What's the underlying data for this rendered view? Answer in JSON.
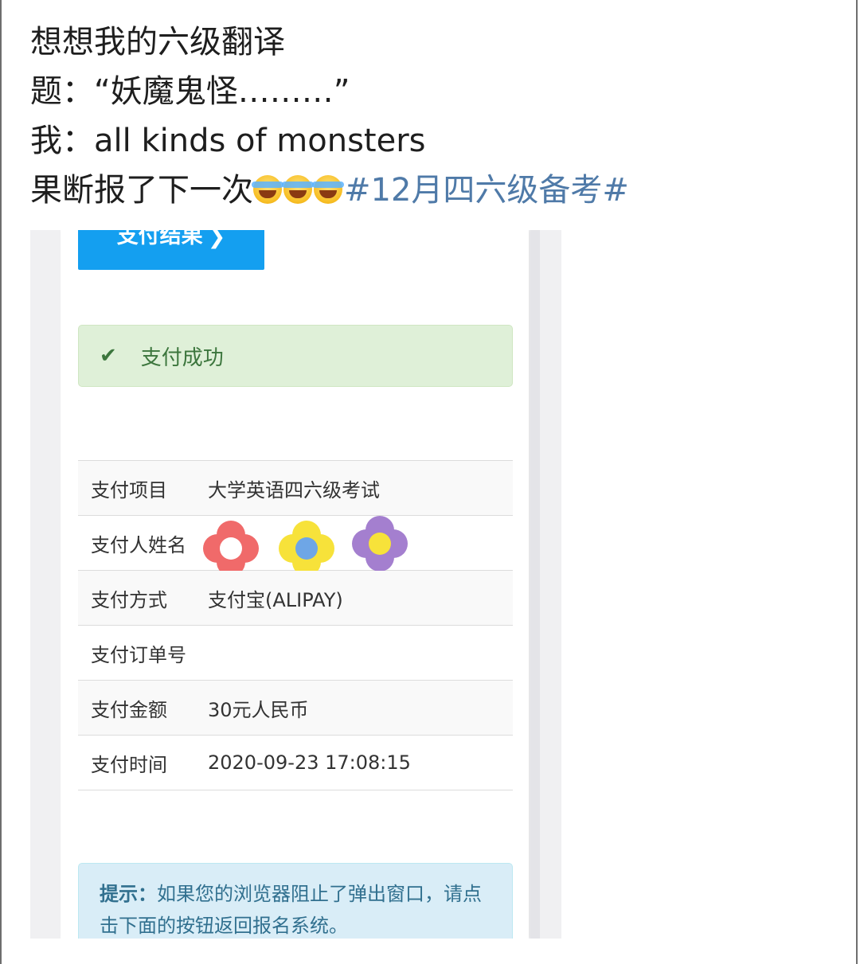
{
  "post": {
    "line1": "想想我的六级翻译",
    "line2": "题：“妖魔鬼怪………”",
    "line3": "我：all kinds of monsters",
    "line4_text": "果断报了下一次",
    "line4_emoji_icon": "laughing-crying-emoji-icon",
    "hashtag": "#12月四六级备考#"
  },
  "screenshot": {
    "result_button_label": "支付结果",
    "result_button_chevron": "❯",
    "success_icon": "check-icon",
    "success_message": "支付成功",
    "rows": [
      {
        "key": "支付项目",
        "value": "大学英语四六级考试"
      },
      {
        "key": "支付人姓名",
        "value": ""
      },
      {
        "key": "支付方式",
        "value": "支付宝(ALIPAY)"
      },
      {
        "key": "支付订单号",
        "value": ""
      },
      {
        "key": "支付金额",
        "value": "30元人民币"
      },
      {
        "key": "支付时间",
        "value": "2020-09-23 17:08:15"
      }
    ],
    "tip_label": "提示：",
    "tip_text": "如果您的浏览器阻止了弹出窗口，请点击下面的按钮返回报名系统。"
  },
  "colors": {
    "hashtag": "#4f7aa8",
    "button_blue": "#149ff0",
    "success_bg": "#dff0d8",
    "success_text": "#3c763d",
    "tip_bg": "#d9edf7",
    "tip_text": "#31708f",
    "flower_red": "#f06a6a",
    "flower_yellow": "#f7e23a",
    "flower_purple": "#a47fcf"
  }
}
